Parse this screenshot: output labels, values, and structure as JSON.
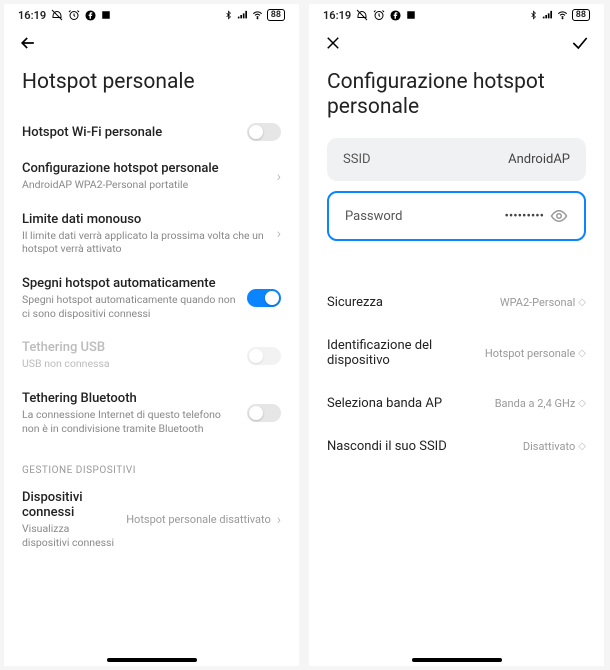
{
  "status": {
    "time": "16:19",
    "battery": "88"
  },
  "left": {
    "title": "Hotspot personale",
    "rows": {
      "wifi": {
        "label": "Hotspot Wi-Fi personale"
      },
      "config": {
        "label": "Configurazione hotspot personale",
        "sub": "AndroidAP WPA2-Personal portatile"
      },
      "limit": {
        "label": "Limite dati monouso",
        "sub": "Il limite dati verrà applicato la prossima volta che un hotspot verrà attivato"
      },
      "autooff": {
        "label": "Spegni hotspot automaticamente",
        "sub": "Spegni hotspot automaticamente quando non ci sono dispositivi connessi"
      },
      "usb": {
        "label": "Tethering USB",
        "sub": "USB non connessa"
      },
      "bt": {
        "label": "Tethering Bluetooth",
        "sub": "La connessione Internet di questo telefono non è in condivisione tramite Bluetooth"
      }
    },
    "section": "GESTIONE DISPOSITIVI",
    "connected": {
      "label": "Dispositivi connessi",
      "sub": "Visualizza dispositivi connessi",
      "value": "Hotspot personale disattivato"
    }
  },
  "right": {
    "title": "Configurazione hotspot personale",
    "ssid": {
      "label": "SSID",
      "value": "AndroidAP"
    },
    "password": {
      "label": "Password",
      "value": "•••••••••"
    },
    "security": {
      "label": "Sicurezza",
      "value": "WPA2-Personal"
    },
    "deviceid": {
      "label": "Identificazione del dispositivo",
      "value": "Hotspot personale"
    },
    "band": {
      "label": "Seleziona banda AP",
      "value": "Banda a 2,4 GHz"
    },
    "hide": {
      "label": "Nascondi il suo SSID",
      "value": "Disattivato"
    }
  }
}
